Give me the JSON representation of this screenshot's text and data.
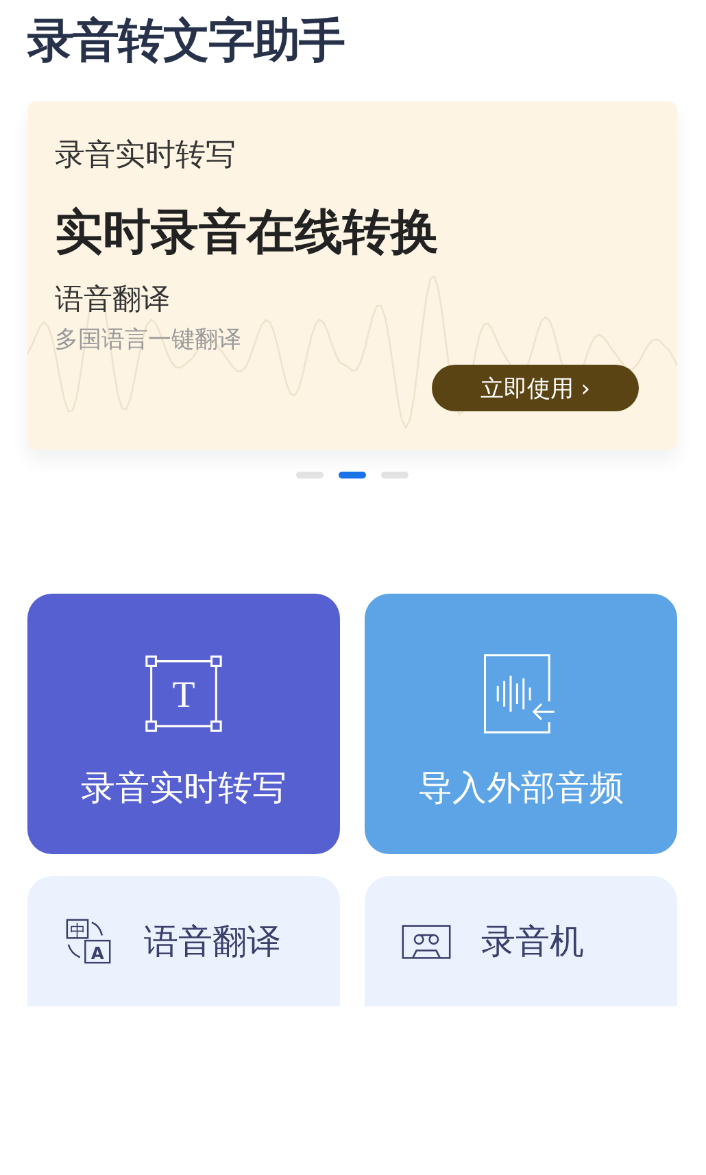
{
  "title": "录音转文字助手",
  "banner": {
    "eyebrow": "录音实时转写",
    "headline": "实时录音在线转换",
    "subtitle": "语音翻译",
    "caption": "多国语言一键翻译",
    "button": "立即使用",
    "button_icon": "›"
  },
  "carousel_dots": [
    {
      "selected": false
    },
    {
      "selected": true
    },
    {
      "selected": false
    }
  ],
  "tiles": [
    {
      "kind": "textbox",
      "glyphs": [
        "T"
      ],
      "label": "录音实时转写",
      "color": "#5660d1"
    },
    {
      "kind": "import",
      "label": "导入外部音频",
      "color": "#5ca4e6"
    },
    {
      "kind": "translate",
      "glyphs": [
        "中",
        "A"
      ],
      "label": "语音翻译",
      "color": "#ecf2fd"
    },
    {
      "kind": "recorder",
      "label": "录音机",
      "color": "#ecf2fd"
    }
  ]
}
